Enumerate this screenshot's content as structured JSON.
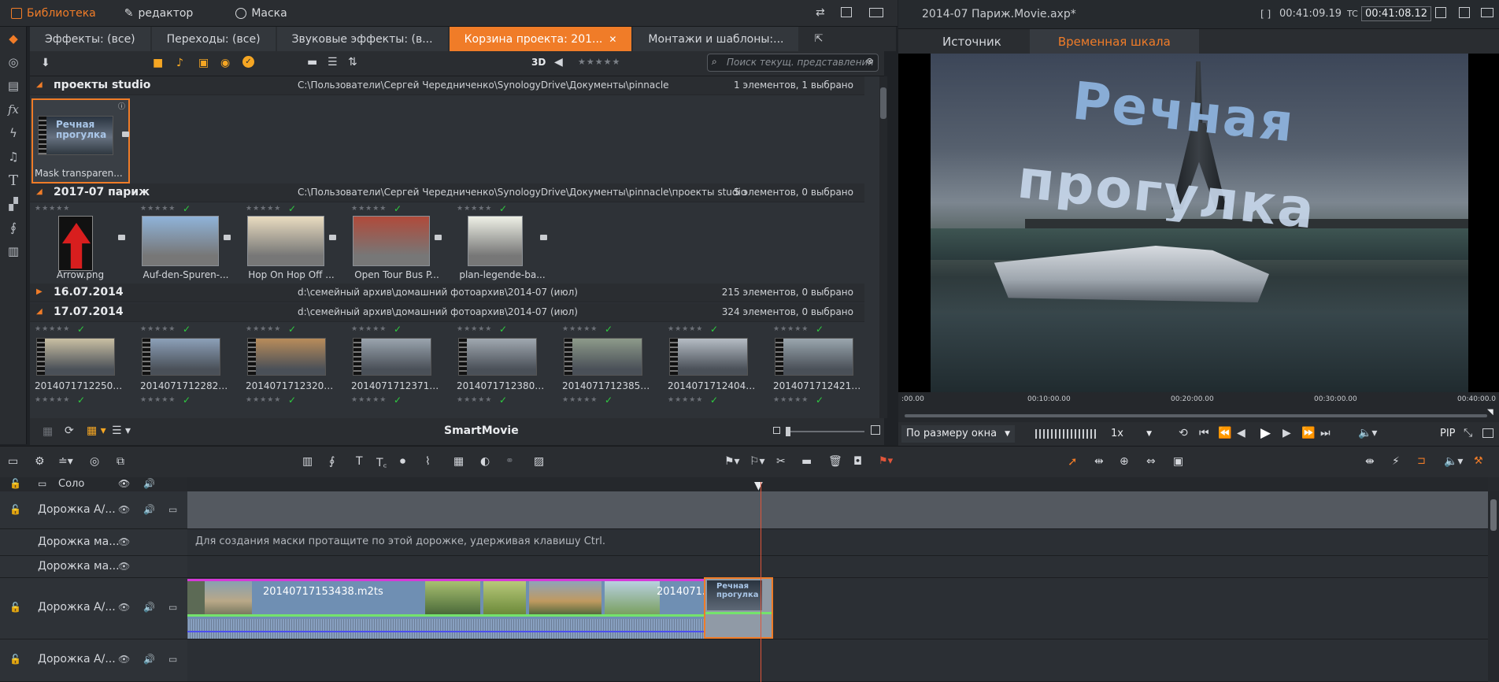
{
  "topbar": {
    "tabs": [
      {
        "label": "Библиотека",
        "active": true
      },
      {
        "label": "редактор",
        "active": false
      },
      {
        "label": "Маска",
        "active": false
      }
    ]
  },
  "library": {
    "tabs": [
      {
        "label": "Эффекты: (все)"
      },
      {
        "label": "Переходы: (все)"
      },
      {
        "label": "Звуковые эффекты: (в..."
      },
      {
        "label": "Корзина проекта: 201...",
        "active": true
      },
      {
        "label": "Монтажи и шаблоны:..."
      }
    ],
    "view_3d": "3D",
    "search_placeholder": "Поиск текущ. представления",
    "groups": [
      {
        "name": "проекты studio",
        "path": "C:\\Пользователи\\Сергей Чередниченко\\SynologyDrive\\Документы\\pinnacle",
        "count": "1 элементов, 1 выбрано",
        "expanded": true
      },
      {
        "name": "2017-07 париж",
        "path": "C:\\Пользователи\\Сергей Чередниченко\\SynologyDrive\\Документы\\pinnacle\\проекты studio",
        "count": "5 элементов, 0 выбрано",
        "expanded": true
      },
      {
        "name": "16.07.2014",
        "path": "d:\\семейный архив\\домашний фотоархив\\2014-07 (июл)",
        "count": "215 элементов, 0 выбрано",
        "expanded": false
      },
      {
        "name": "17.07.2014",
        "path": "d:\\семейный архив\\домашний фотоархив\\2014-07 (июл)",
        "count": "324 элементов, 0 выбрано",
        "expanded": true
      }
    ],
    "project_items": [
      {
        "caption": "Mask transparen...",
        "thumb_text": "Речная прогулка"
      }
    ],
    "paris_items": [
      {
        "caption": "Arrow.png",
        "color": "#d81e1e"
      },
      {
        "caption": "Auf-den-Spuren-...",
        "color": "#8fb3d9"
      },
      {
        "caption": "Hop On Hop Off ...",
        "color": "#e9dcc0"
      },
      {
        "caption": "Open Tour Bus P...",
        "color": "#b04a3a"
      },
      {
        "caption": "plan-legende-ba...",
        "color": "#eef0e6"
      }
    ],
    "day_items": [
      {
        "caption": "20140717122500..."
      },
      {
        "caption": "20140717122821..."
      },
      {
        "caption": "20140717123202..."
      },
      {
        "caption": "20140717123713..."
      },
      {
        "caption": "20140717123807..."
      },
      {
        "caption": "20140717123854..."
      },
      {
        "caption": "20140717124049..."
      },
      {
        "caption": "20140717124213..."
      }
    ],
    "bottom_title": "SmartMovie"
  },
  "player": {
    "file": "2014-07 Париж.Movie.axp*",
    "timecode_label": "[ ]",
    "duration": "00:41:09.19",
    "tc_label": "TC",
    "tc_value": "00:41:08.12",
    "tabs": [
      {
        "label": "Источник",
        "active": false
      },
      {
        "label": "Временная шкала",
        "active": true
      }
    ],
    "overlay_line1": "Речная",
    "overlay_line2": "прогулка",
    "ruler": ":00.00",
    "ruler_ticks": [
      "00:10:00.00",
      "00:20:00.00",
      "00:30:00.00",
      "00:40:00.0"
    ],
    "fit": "По размеру окна",
    "speed": "1x",
    "pip": "PIP"
  },
  "timeline": {
    "solo": "Соло",
    "tracks": [
      {
        "name": "Дорожка А/..."
      },
      {
        "name": "Дорожка ма..."
      },
      {
        "name": "Дорожка ма..."
      },
      {
        "name": "Дорожка А/..."
      },
      {
        "name": "Дорожка А/..."
      }
    ],
    "mask_hint": "Для создания маски протащите по этой дорожке, удерживая клавишу Ctrl.",
    "clip1": "20140717153438.m2ts",
    "clip2": "2014071...",
    "clip3_text": "Речная прогулка"
  },
  "colors": {
    "accent": "#f07c28",
    "check": "#2ecc40"
  }
}
